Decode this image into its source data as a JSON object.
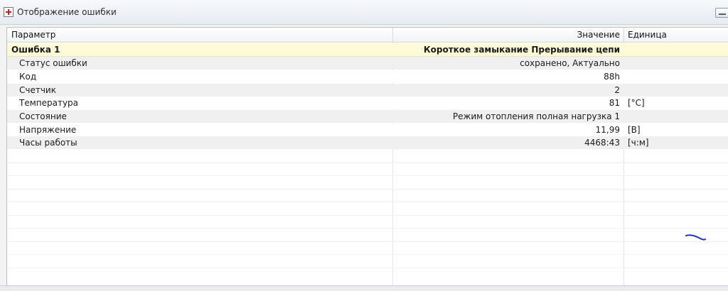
{
  "window": {
    "title": "Отображение ошибки",
    "icon": "red-cross-icon"
  },
  "table": {
    "columns": {
      "parameter": "Параметр",
      "value": "Значение",
      "unit": "Единица"
    },
    "group": {
      "label": "Ошибка 1",
      "value": "Короткое замыкание Прерывание цепи",
      "unit": ""
    },
    "rows": [
      {
        "param": "Статус ошибки",
        "value": "сохранено, Актуально",
        "unit": ""
      },
      {
        "param": "Код",
        "value": "88h",
        "unit": ""
      },
      {
        "param": "Счетчик",
        "value": "2",
        "unit": ""
      },
      {
        "param": "Температура",
        "value": "81",
        "unit": "[°C]"
      },
      {
        "param": "Состояние",
        "value": "Режим отопления полная нагрузка 1",
        "unit": ""
      },
      {
        "param": "Напряжение",
        "value": "11,99",
        "unit": "[В]"
      },
      {
        "param": "Часы работы",
        "value": "4468:43",
        "unit": "[ч:м]"
      }
    ]
  },
  "colors": {
    "group_row": "#fdfbd7",
    "alt_row": "#f0f0f0",
    "pen_mark": "#1f2fbf"
  }
}
